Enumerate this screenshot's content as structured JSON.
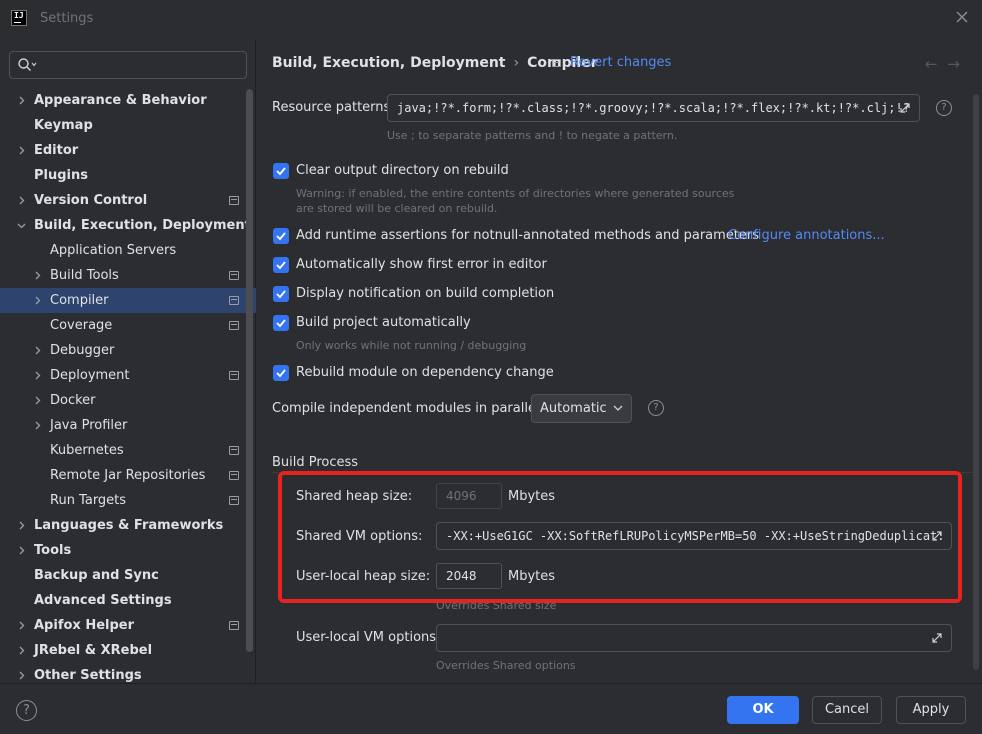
{
  "window": {
    "title": "Settings",
    "app_icon_text": "IJ"
  },
  "search": {
    "placeholder": ""
  },
  "sidebar": {
    "items": [
      {
        "label": "Appearance & Behavior",
        "bold": true,
        "chevron": "right"
      },
      {
        "label": "Keymap",
        "bold": true
      },
      {
        "label": "Editor",
        "bold": true,
        "chevron": "right"
      },
      {
        "label": "Plugins",
        "bold": true
      },
      {
        "label": "Version Control",
        "bold": true,
        "chevron": "right",
        "pin": true
      },
      {
        "label": "Build, Execution, Deployment",
        "bold": true,
        "chevron": "down"
      },
      {
        "label": "Application Servers",
        "indent": true
      },
      {
        "label": "Build Tools",
        "indent": true,
        "chevron": "right",
        "pin": true
      },
      {
        "label": "Compiler",
        "indent": true,
        "chevron": "right",
        "pin": true,
        "selected": true
      },
      {
        "label": "Coverage",
        "indent": true,
        "pin": true
      },
      {
        "label": "Debugger",
        "indent": true,
        "chevron": "right"
      },
      {
        "label": "Deployment",
        "indent": true,
        "chevron": "right",
        "pin": true
      },
      {
        "label": "Docker",
        "indent": true,
        "chevron": "right"
      },
      {
        "label": "Java Profiler",
        "indent": true,
        "chevron": "right"
      },
      {
        "label": "Kubernetes",
        "indent": true,
        "pin": true
      },
      {
        "label": "Remote Jar Repositories",
        "indent": true,
        "pin": true
      },
      {
        "label": "Run Targets",
        "indent": true,
        "pin": true
      },
      {
        "label": "Languages & Frameworks",
        "bold": true,
        "chevron": "right"
      },
      {
        "label": "Tools",
        "bold": true,
        "chevron": "right"
      },
      {
        "label": "Backup and Sync",
        "bold": true
      },
      {
        "label": "Advanced Settings",
        "bold": true
      },
      {
        "label": "Apifox Helper",
        "bold": true,
        "chevron": "right",
        "pin": true
      },
      {
        "label": "JRebel & XRebel",
        "bold": true,
        "chevron": "right"
      },
      {
        "label": "Other Settings",
        "bold": true,
        "chevron": "right"
      }
    ]
  },
  "header": {
    "breadcrumb_parent": "Build, Execution, Deployment",
    "breadcrumb_sep": "›",
    "breadcrumb_current": "Compiler",
    "revert_label": "Revert changes",
    "nav_back": "←",
    "nav_forward": "→"
  },
  "compiler": {
    "resource_patterns_label": "Resource patterns:",
    "resource_patterns_value": "java;!?*.form;!?*.class;!?*.groovy;!?*.scala;!?*.flex;!?*.kt;!?*.clj;!?",
    "resource_patterns_hint": "Use ; to separate patterns and ! to negate a pattern.",
    "clear_output_label": "Clear output directory on rebuild",
    "clear_output_hint1": "Warning: if enabled, the entire contents of directories where generated sources",
    "clear_output_hint2": "are stored will be cleared on rebuild.",
    "runtime_assertions_label": "Add runtime assertions for notnull-annotated methods and parameters",
    "configure_annotations_link": "Configure annotations...",
    "show_first_error_label": "Automatically show first error in editor",
    "notification_label": "Display notification on build completion",
    "build_auto_label": "Build project automatically",
    "build_auto_hint": "Only works while not running / debugging",
    "rebuild_module_label": "Rebuild module on dependency change",
    "parallel_label": "Compile independent modules in parallel:",
    "parallel_value": "Automatic",
    "help_symbol": "?"
  },
  "build_process": {
    "section_title": "Build Process",
    "shared_heap_label": "Shared heap size:",
    "shared_heap_value": "4096",
    "shared_heap_unit": "Mbytes",
    "shared_vm_label": "Shared VM options:",
    "shared_vm_value": "-XX:+UseG1GC -XX:SoftRefLRUPolicyMSPerMB=50 -XX:+UseStringDeduplicat:",
    "user_heap_label": "User-local heap size:",
    "user_heap_value": "2048",
    "user_heap_unit": "Mbytes",
    "user_heap_hint": "Overrides Shared size",
    "user_vm_label": "User-local VM options:",
    "user_vm_value": "",
    "user_vm_hint": "Overrides Shared options"
  },
  "footer": {
    "help_symbol": "?",
    "ok_label": "OK",
    "cancel_label": "Cancel",
    "apply_label": "Apply"
  },
  "colors": {
    "accent": "#3574f0",
    "link": "#548af7",
    "highlight_box": "#e8221f",
    "selected_row": "#2e436e"
  }
}
